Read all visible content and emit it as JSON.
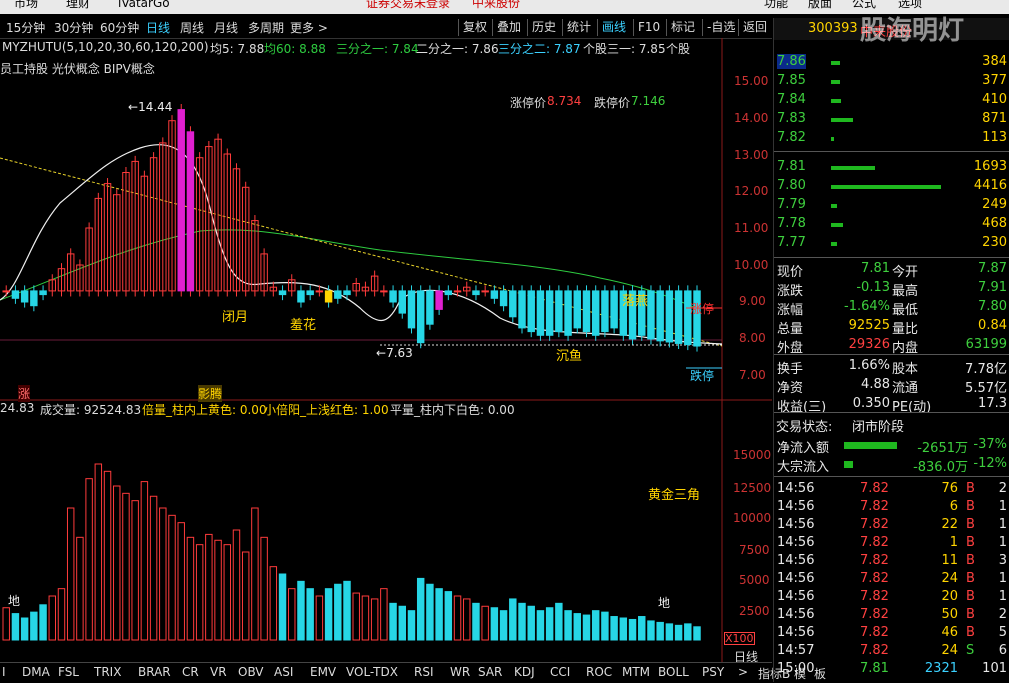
{
  "topmenu": {
    "items": [
      "市场",
      "理财",
      "iVatarGo",
      "功能",
      "版面",
      "公式",
      "选项"
    ],
    "center_text": "证券交易未登录",
    "center_text2": "中来股份"
  },
  "toolbar": {
    "periods": [
      "15分钟",
      "30分钟",
      "60分钟",
      "日线",
      "周线",
      "月线",
      "多周期",
      "更多 >"
    ],
    "selected": "日线",
    "buttons": [
      "复权",
      "叠加",
      "历史",
      "统计",
      "画线",
      "F10",
      "标记",
      "-自选",
      "返回"
    ]
  },
  "indicator_line": {
    "name": "MYZHUTU(5,10,20,30,60,120,200)",
    "ma5": "均5: 7.88",
    "ma60": "均60: 8.88",
    "third1": "三分之一: 7.84",
    "half": "二分之一: 7.86",
    "third2": "三分之二: 7.87",
    "one_third_stock": "个股三一: 7.85",
    "gegu": "个股"
  },
  "concepts": "员工持股 光伏概念 BIPV概念",
  "price_labels": {
    "limit_up": "涨停价",
    "limit_up_val": "8.734",
    "limit_down": "跌停价",
    "limit_down_val": "7.146",
    "high": "14.44",
    "low": "7.63",
    "pattern1": "闭月",
    "pattern2": "羞花",
    "pattern3": "沉鱼",
    "pattern4": "落燕",
    "zhangting": "涨停",
    "dieting": "跌停",
    "zhang_tag": "涨",
    "ying_tag": "影腾"
  },
  "price_axis": [
    "15.00",
    "14.00",
    "13.00",
    "12.00",
    "11.00",
    "10.00",
    "9.00",
    "8.00",
    "7.00"
  ],
  "volume_line": {
    "val": "24.83",
    "label": "成交量: 92524.83",
    "b1": "倍量_柱内上黄色: 0.00",
    "b2": "小倍阳_上浅红色: 1.00",
    "b3": "平量_柱内下白色: 0.00"
  },
  "volume_axis": [
    "15000",
    "12500",
    "10000",
    "7500",
    "5000",
    "2500"
  ],
  "volume_labels": {
    "golden": "黄金三角",
    "di1": "地",
    "di2": "地",
    "x100": "X100",
    "daily": "日线"
  },
  "bottom_tabs": [
    "I",
    "DMA",
    "FSL",
    "TRIX",
    "BRAR",
    "CR",
    "VR",
    "OBV",
    "ASI",
    "EMV",
    "VOL-TDX",
    "RSI",
    "WR",
    "SAR",
    "KDJ",
    "CCI",
    "ROC",
    "MTM",
    "BOLL",
    "PSY",
    ">",
    "指标B",
    "模",
    "板"
  ],
  "quote": {
    "code": "300393",
    "name": "中来股份",
    "watermark": "股海明灯",
    "asks": [
      {
        "price": "7.86",
        "vol": "384",
        "bar": 0.08
      },
      {
        "price": "7.85",
        "vol": "377",
        "bar": 0.08
      },
      {
        "price": "7.84",
        "vol": "410",
        "bar": 0.09
      },
      {
        "price": "7.83",
        "vol": "871",
        "bar": 0.2
      },
      {
        "price": "7.82",
        "vol": "113",
        "bar": 0.02
      }
    ],
    "bids": [
      {
        "price": "7.81",
        "vol": "1693",
        "bar": 0.4
      },
      {
        "price": "7.80",
        "vol": "4416",
        "bar": 1.0
      },
      {
        "price": "7.79",
        "vol": "249",
        "bar": 0.05
      },
      {
        "price": "7.78",
        "vol": "468",
        "bar": 0.11
      },
      {
        "price": "7.77",
        "vol": "230",
        "bar": 0.05
      }
    ],
    "stats": [
      {
        "l1": "现价",
        "v1": "7.81",
        "c1": "green",
        "l2": "今开",
        "v2": "7.87",
        "c2": "green"
      },
      {
        "l1": "涨跌",
        "v1": "-0.13",
        "c1": "green",
        "l2": "最高",
        "v2": "7.91",
        "c2": "green"
      },
      {
        "l1": "涨幅",
        "v1": "-1.64%",
        "c1": "green",
        "l2": "最低",
        "v2": "7.80",
        "c2": "green"
      },
      {
        "l1": "总量",
        "v1": "92525",
        "c1": "yellow",
        "l2": "量比",
        "v2": "0.84",
        "c2": "yellow"
      },
      {
        "l1": "外盘",
        "v1": "29326",
        "c1": "red",
        "l2": "内盘",
        "v2": "63199",
        "c2": "green"
      }
    ],
    "stats2": [
      {
        "l1": "换手",
        "v1": "1.66%",
        "l2": "股本",
        "v2": "7.78亿"
      },
      {
        "l1": "净资",
        "v1": "4.88",
        "l2": "流通",
        "v2": "5.57亿"
      },
      {
        "l1": "收益(三)",
        "v1": "0.350",
        "l2": "PE(动)",
        "v2": "17.3"
      }
    ],
    "trade_status_label": "交易状态:",
    "trade_status": "闭市阶段",
    "flow": [
      {
        "label": "净流入额",
        "val": "-2651万",
        "pct": "-37%",
        "bar": 0.85
      },
      {
        "label": "大宗流入",
        "val": "-836.0万",
        "pct": "-12%",
        "bar": 0.15
      }
    ],
    "ticks": [
      {
        "t": "14:56",
        "p": "7.82",
        "v": "76",
        "bs": "B",
        "n": "2"
      },
      {
        "t": "14:56",
        "p": "7.82",
        "v": "6",
        "bs": "B",
        "n": "1"
      },
      {
        "t": "14:56",
        "p": "7.82",
        "v": "22",
        "bs": "B",
        "n": "1"
      },
      {
        "t": "14:56",
        "p": "7.82",
        "v": "1",
        "bs": "B",
        "n": "1"
      },
      {
        "t": "14:56",
        "p": "7.82",
        "v": "11",
        "bs": "B",
        "n": "3"
      },
      {
        "t": "14:56",
        "p": "7.82",
        "v": "24",
        "bs": "B",
        "n": "1"
      },
      {
        "t": "14:56",
        "p": "7.82",
        "v": "20",
        "bs": "B",
        "n": "1"
      },
      {
        "t": "14:56",
        "p": "7.82",
        "v": "50",
        "bs": "B",
        "n": "2"
      },
      {
        "t": "14:56",
        "p": "7.82",
        "v": "46",
        "bs": "B",
        "n": "5"
      },
      {
        "t": "14:57",
        "p": "7.82",
        "v": "24",
        "bs": "S",
        "n": "6"
      },
      {
        "t": "15:00",
        "p": "7.81",
        "v": "2321",
        "bs": "",
        "n": "101"
      }
    ]
  }
}
